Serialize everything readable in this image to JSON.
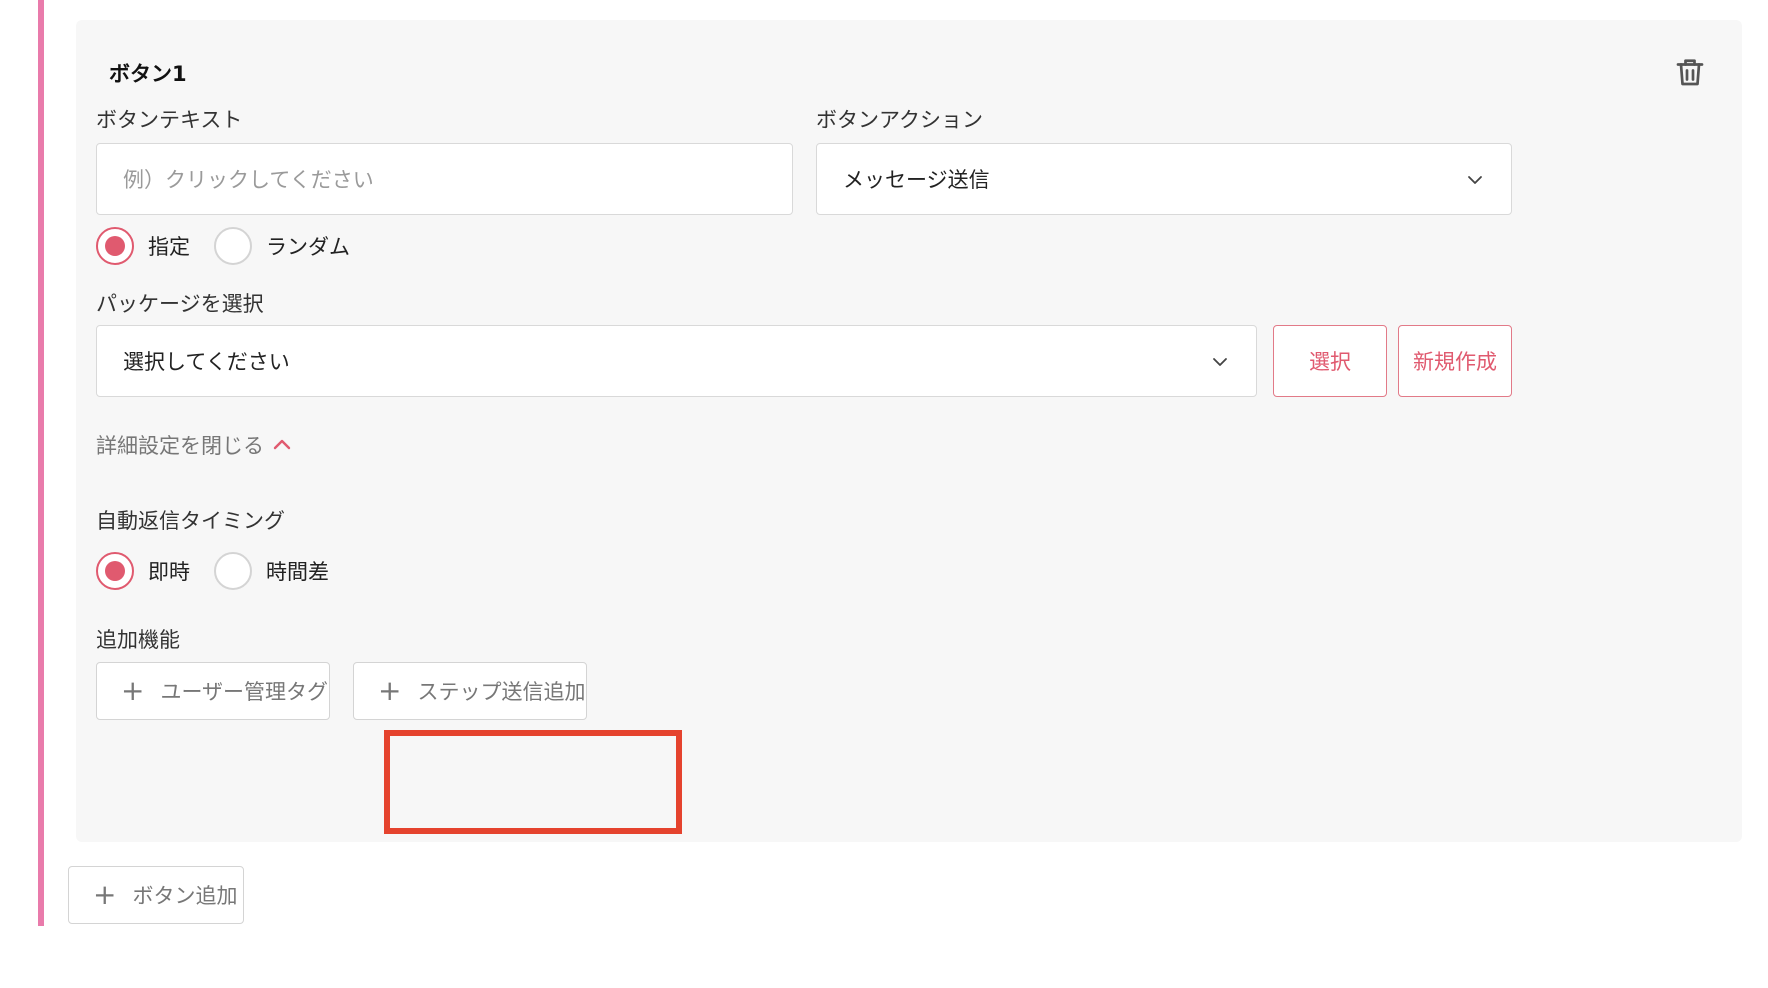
{
  "card": {
    "title": "ボタン1",
    "icons": {
      "delete": "trash-icon"
    },
    "button_text": {
      "label": "ボタンテキスト",
      "placeholder": "例）クリックしてください"
    },
    "button_action": {
      "label": "ボタンアクション",
      "value": "メッセージ送信"
    },
    "mode": {
      "options": [
        {
          "label": "指定",
          "checked": true
        },
        {
          "label": "ランダム",
          "checked": false
        }
      ]
    },
    "package": {
      "label": "パッケージを選択",
      "value": "選択してください",
      "select_button": "選択",
      "new_button": "新規作成"
    },
    "details_toggle": "詳細設定を閉じる",
    "auto_reply": {
      "label": "自動返信タイミング",
      "options": [
        {
          "label": "即時",
          "checked": true
        },
        {
          "label": "時間差",
          "checked": false
        }
      ]
    },
    "extras": {
      "label": "追加機能",
      "user_tag_button": "ユーザー管理タグ",
      "step_send_button": "ステップ送信追加"
    }
  },
  "add_button": "ボタン追加",
  "colors": {
    "accent": "#e05a6f",
    "side_bar": "#e97bab",
    "highlight": "#e5432e"
  }
}
